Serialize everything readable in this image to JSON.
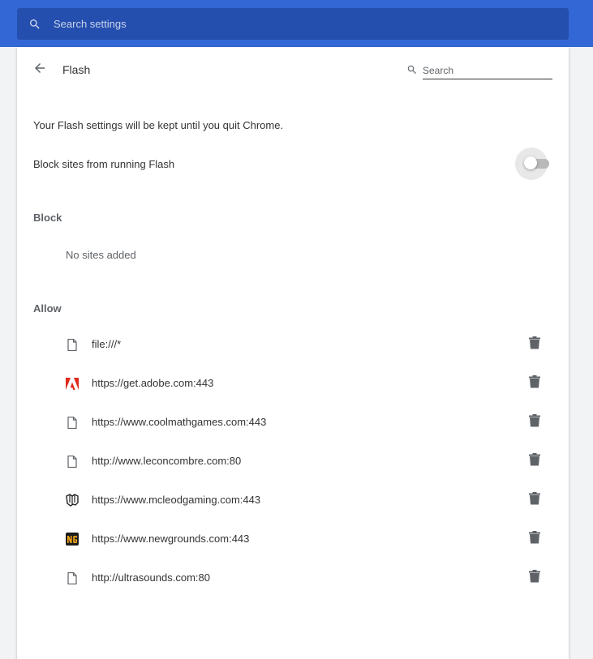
{
  "topbar": {
    "search_placeholder": "Search settings",
    "search_icon": "search-icon"
  },
  "header": {
    "back_icon": "arrow-back-icon",
    "title": "Flash",
    "search_placeholder": "Search",
    "search_icon": "search-icon"
  },
  "info_text": "Your Flash settings will be kept until you quit Chrome.",
  "block_toggle": {
    "label": "Block sites from running Flash",
    "enabled": false
  },
  "block_section": {
    "title": "Block",
    "empty_text": "No sites added"
  },
  "allow_section": {
    "title": "Allow",
    "sites": [
      {
        "url": "file:///*",
        "favicon": "file-icon"
      },
      {
        "url": "https://get.adobe.com:443",
        "favicon": "adobe-icon"
      },
      {
        "url": "https://www.coolmathgames.com:443",
        "favicon": "file-icon"
      },
      {
        "url": "http://www.leconcombre.com:80",
        "favicon": "file-icon"
      },
      {
        "url": "https://www.mcleodgaming.com:443",
        "favicon": "mcleodgaming-icon"
      },
      {
        "url": "https://www.newgrounds.com:443",
        "favicon": "newgrounds-icon"
      },
      {
        "url": "http://ultrasounds.com:80",
        "favicon": "file-icon"
      }
    ],
    "delete_icon": "trash-icon"
  },
  "colors": {
    "topbar": "#3367d6",
    "search_box": "#254fae",
    "adobe_red": "#e0291b",
    "newgrounds_orange": "#f1a219"
  }
}
